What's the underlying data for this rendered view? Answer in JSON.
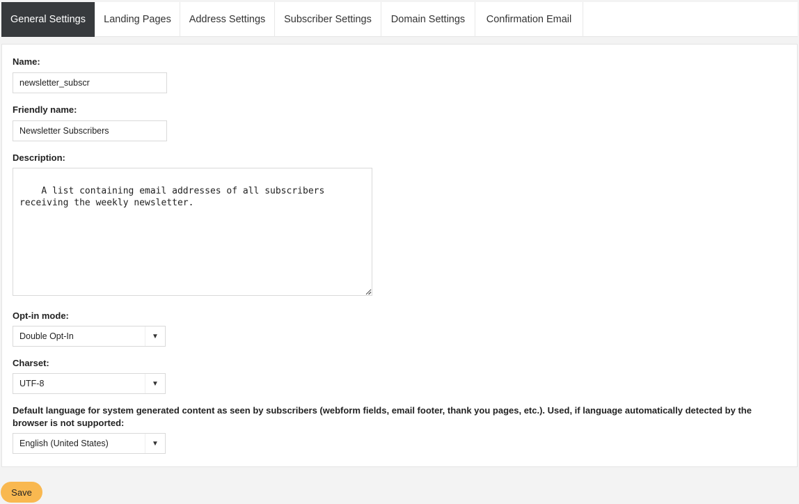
{
  "tabs": [
    {
      "label": "General Settings"
    },
    {
      "label": "Landing Pages"
    },
    {
      "label": "Address Settings"
    },
    {
      "label": "Subscriber Settings"
    },
    {
      "label": "Domain Settings"
    },
    {
      "label": "Confirmation Email"
    }
  ],
  "form": {
    "name_label": "Name:",
    "name_value": "newsletter_subscr",
    "friendly_label": "Friendly name:",
    "friendly_value": "Newsletter Subscribers",
    "description_label": "Description:",
    "description_value": "A list containing email addresses of all subscribers receiving the weekly newsletter.",
    "optin_label": "Opt-in mode:",
    "optin_value": "Double Opt-In",
    "charset_label": "Charset:",
    "charset_value": "UTF-8",
    "language_label": "Default language for system generated content as seen by subscribers (webform fields, email footer, thank you pages, etc.). Used, if language automatically detected by the browser is not supported:",
    "language_value": "English (United States)"
  },
  "actions": {
    "save_label": "Save"
  },
  "icons": {
    "select_arrow": "triangle-down-icon",
    "resize": "resize-grip-icon"
  },
  "colors": {
    "active_tab": "#373a3d",
    "save_button": "#f9b850"
  }
}
